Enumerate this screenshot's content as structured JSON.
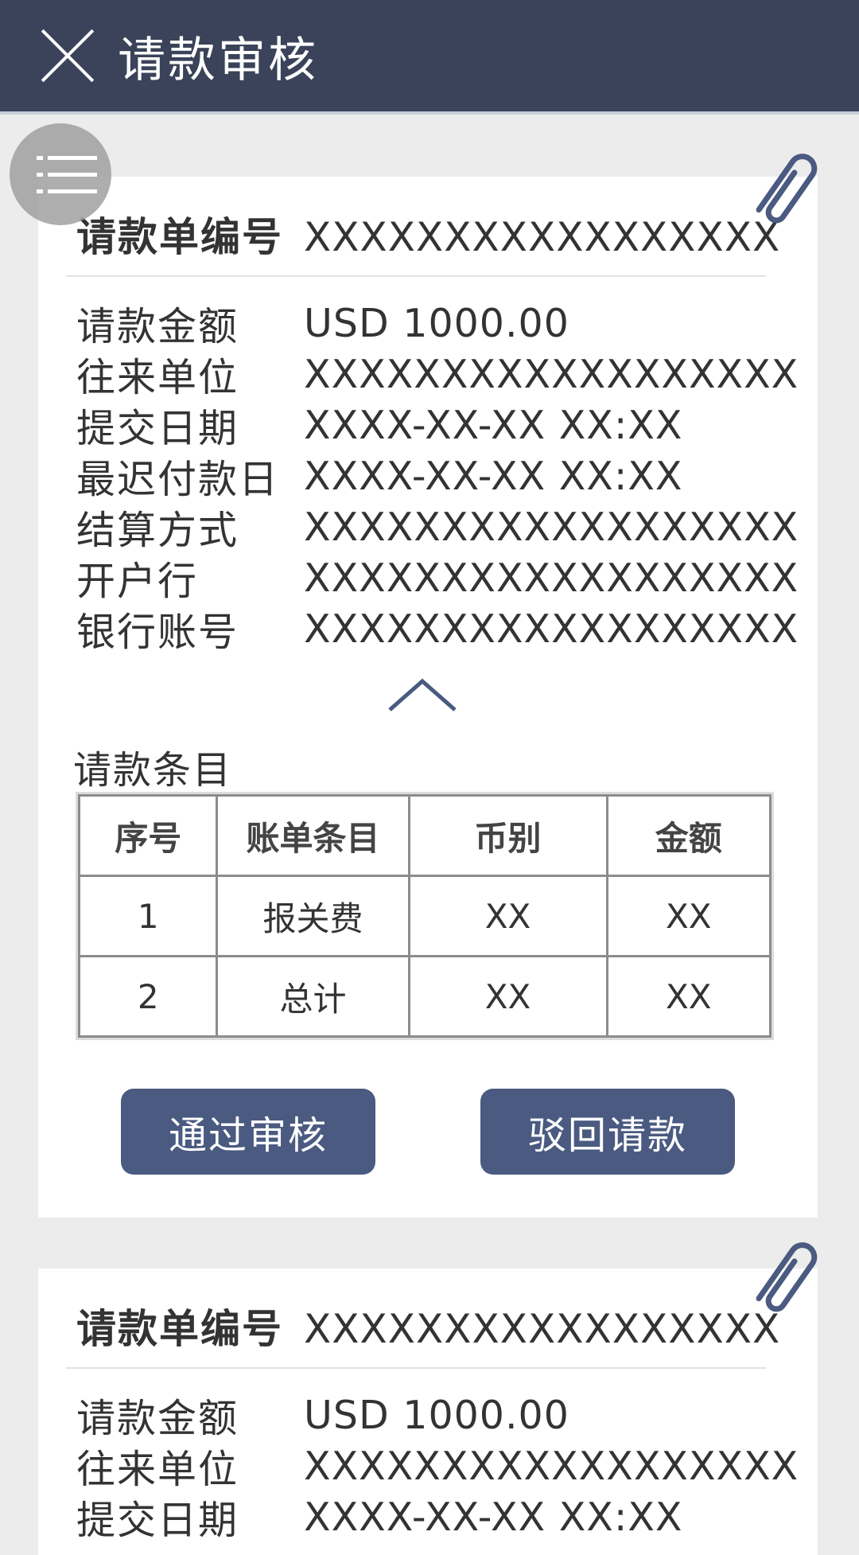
{
  "header": {
    "title": "请款审核"
  },
  "cards": [
    {
      "number_label": "请款单编号",
      "number_value": "XXXXXXXXXXXXXXXXX",
      "fields": [
        {
          "label": "请款金额",
          "value": "USD 1000.00"
        },
        {
          "label": "往来单位",
          "value": "XXXXXXXXXXXXXXXXXX"
        },
        {
          "label": "提交日期",
          "value": "XXXX-XX-XX XX:XX"
        },
        {
          "label": "最迟付款日",
          "value": "XXXX-XX-XX XX:XX"
        },
        {
          "label": "结算方式",
          "value": "XXXXXXXXXXXXXXXXXX"
        },
        {
          "label": "开户行",
          "value": "XXXXXXXXXXXXXXXXXX"
        },
        {
          "label": "银行账号",
          "value": "XXXXXXXXXXXXXXXXXX"
        }
      ],
      "items_title": "请款条目",
      "table": {
        "headers": [
          "序号",
          "账单条目",
          "币别",
          "金额"
        ],
        "rows": [
          [
            "1",
            "报关费",
            "XX",
            "XX"
          ],
          [
            "2",
            "总计",
            "XX",
            "XX"
          ]
        ]
      },
      "approve_label": "通过审核",
      "reject_label": "驳回请款"
    },
    {
      "number_label": "请款单编号",
      "number_value": "XXXXXXXXXXXXXXXXX",
      "fields": [
        {
          "label": "请款金额",
          "value": "USD 1000.00"
        },
        {
          "label": "往来单位",
          "value": "XXXXXXXXXXXXXXXXXX"
        },
        {
          "label": "提交日期",
          "value": "XXXX-XX-XX XX:XX"
        }
      ]
    }
  ],
  "icons": {
    "close": "close-icon",
    "menu": "menu-icon",
    "attachment": "paperclip-icon",
    "collapse": "chevron-up-icon"
  },
  "colors": {
    "header_bg": "#3a4359",
    "button_bg": "#4a5a80",
    "page_bg": "#ececec"
  }
}
